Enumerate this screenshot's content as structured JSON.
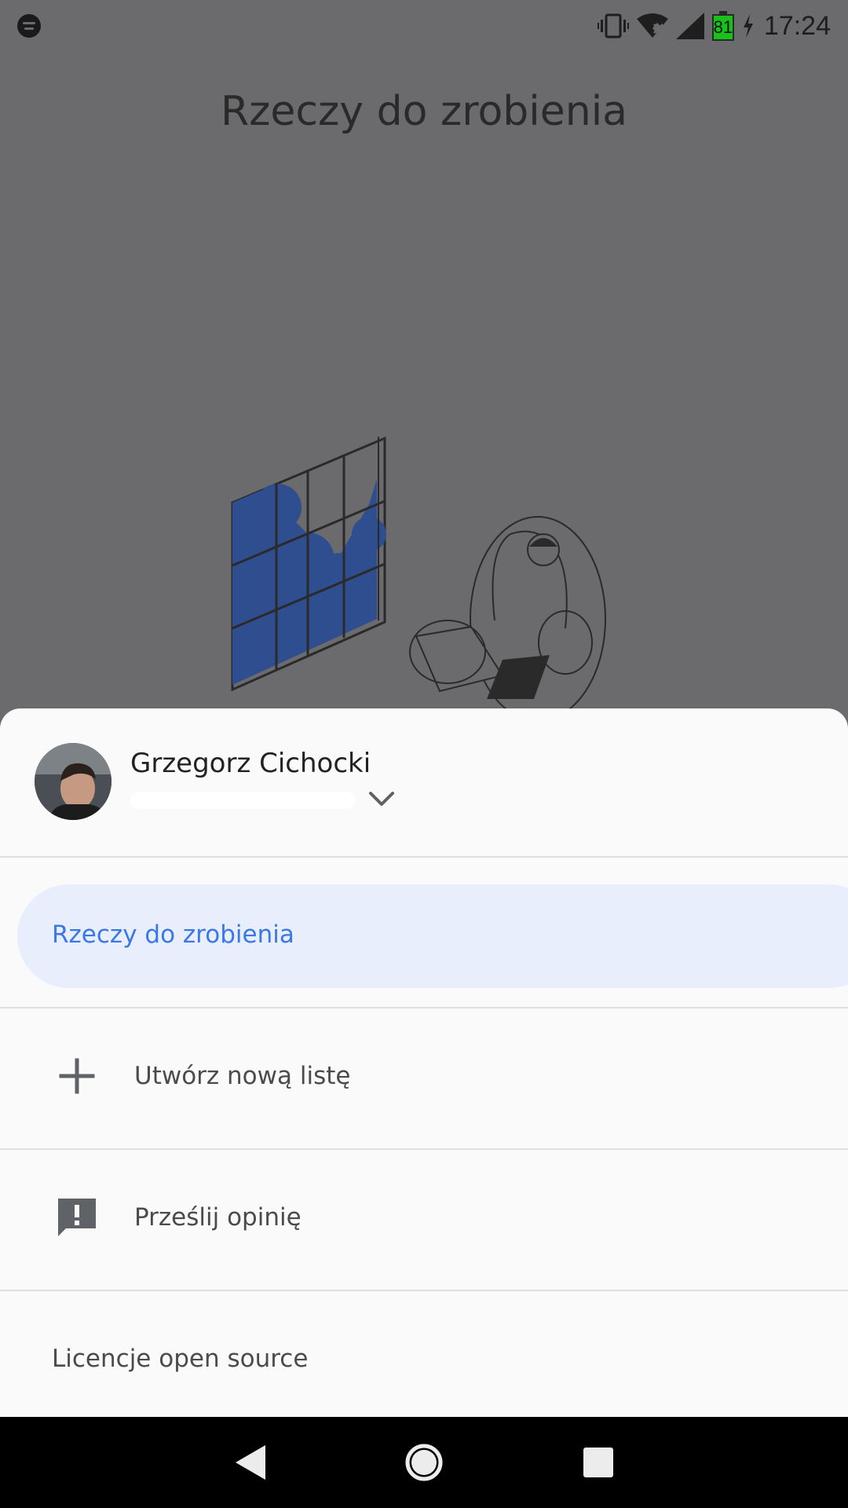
{
  "status_bar": {
    "time": "17:24",
    "battery_level": "81",
    "icons": [
      "spotify-icon",
      "vibrate-icon",
      "wifi-icon",
      "signal-icon",
      "battery-icon",
      "charging-icon"
    ]
  },
  "page": {
    "title": "Rzeczy do zrobienia"
  },
  "sheet": {
    "account": {
      "name": "Grzegorz Cichocki"
    },
    "lists": [
      {
        "label": "Rzeczy do zrobienia",
        "selected": true
      }
    ],
    "menu": {
      "new_list_label": "Utwórz nową listę",
      "feedback_label": "Prześlij opinię",
      "licenses_label": "Licencje open source"
    }
  },
  "colors": {
    "scrim": "#6b6b6d",
    "sheet_bg": "#fafafa",
    "selected_bg": "#e8eefb",
    "accent": "#3b78e7",
    "battery_fill": "#18c21b"
  }
}
